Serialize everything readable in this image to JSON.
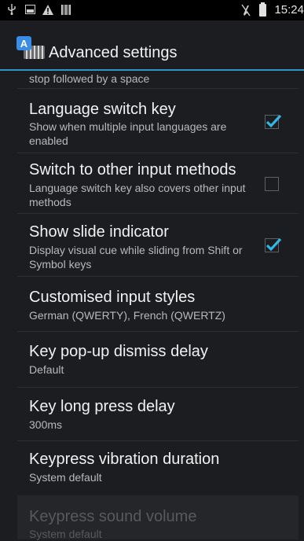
{
  "status_bar": {
    "icons": [
      "usb-icon",
      "image-icon",
      "warning-icon",
      "barcode-icon"
    ],
    "right_icons": [
      "mute-icon",
      "battery-icon"
    ],
    "time": "15:24"
  },
  "action_bar": {
    "title": "Advanced settings",
    "app_icon_letter": "A"
  },
  "settings": {
    "partial_top": {
      "summary": "stop followed by a space"
    },
    "items": [
      {
        "title": "Language switch key",
        "summary": "Show when multiple input languages are enabled",
        "checked": true
      },
      {
        "title": "Switch to other input methods",
        "summary": "Language switch key also covers other input methods",
        "checked": false
      },
      {
        "title": "Show slide indicator",
        "summary": "Display visual cue while sliding from Shift or Symbol keys",
        "checked": true
      },
      {
        "title": "Customised input styles",
        "summary": "German (QWERTY), French (QWERTZ)"
      },
      {
        "title": "Key pop-up dismiss delay",
        "summary": "Default"
      },
      {
        "title": "Key long press delay",
        "summary": "300ms"
      },
      {
        "title": "Keypress vibration duration",
        "summary": "System default"
      },
      {
        "title": "Keypress sound volume",
        "summary": "System default",
        "enabled": false
      }
    ]
  },
  "colors": {
    "accent": "#2b97c4",
    "checkbox": "#33b5e5",
    "background": "#1b1d20"
  }
}
